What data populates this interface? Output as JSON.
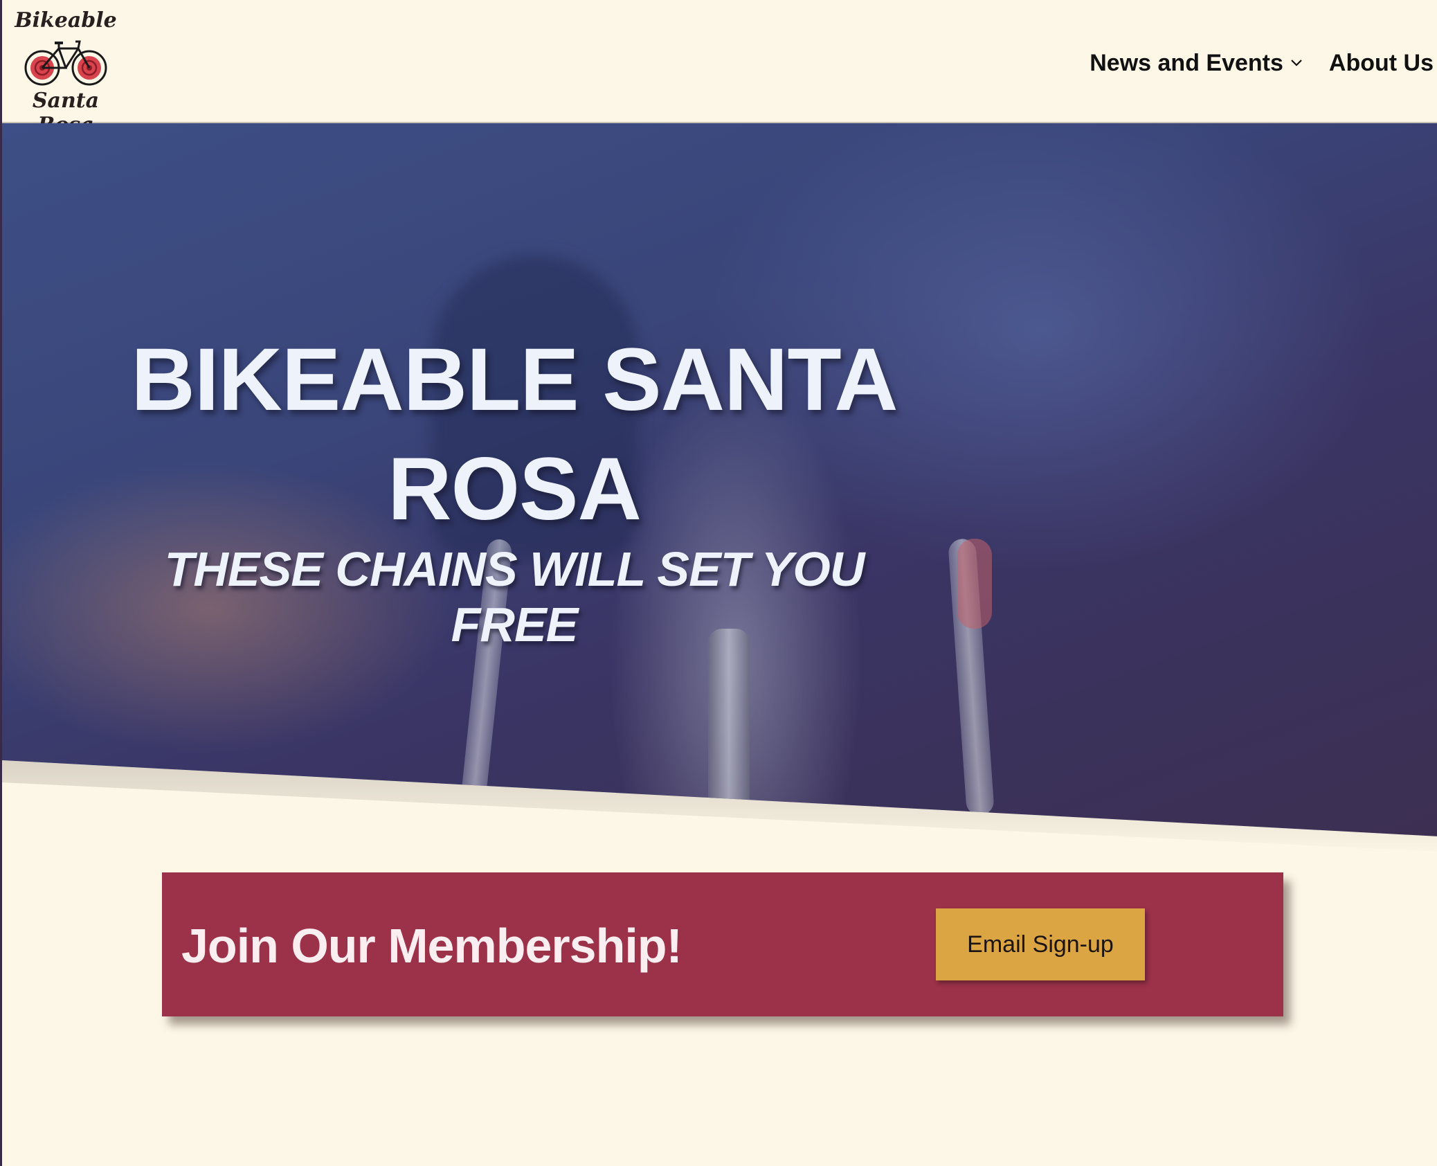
{
  "header": {
    "logo": {
      "top_text": "Bikeable",
      "bottom_text": "Santa Rosa",
      "icon": "bicycle-rose-logo"
    },
    "nav": [
      {
        "label": "News and Events",
        "icon": "chevron-down-icon"
      },
      {
        "label": "About Us",
        "icon": "chevron-down-icon"
      }
    ]
  },
  "hero": {
    "title": "BIKEABLE SANTA ROSA",
    "tagline": "THESE CHAINS WILL SET YOU FREE"
  },
  "membership": {
    "heading": "Join Our Membership!",
    "button_label": "Email Sign-up"
  },
  "colors": {
    "background": "#fdf7e8",
    "banner": "#9c314a",
    "button": "#dba543",
    "hero_text": "#eef2fb"
  }
}
